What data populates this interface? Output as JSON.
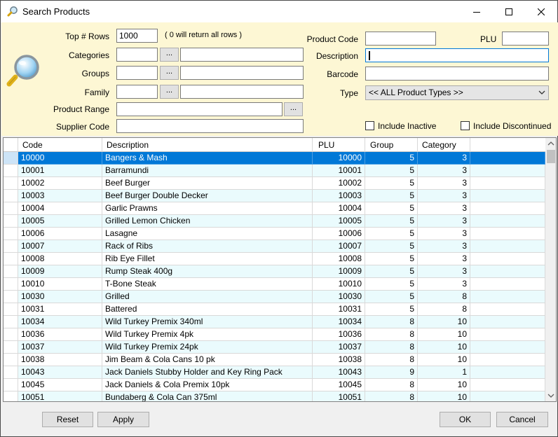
{
  "window": {
    "title": "Search Products",
    "icon": "magnifier-icon"
  },
  "filters": {
    "top_rows": {
      "label": "Top # Rows",
      "value": "1000",
      "hint": "( 0 will return all rows )"
    },
    "categories": {
      "label": "Categories",
      "code": "",
      "name": ""
    },
    "groups": {
      "label": "Groups",
      "code": "",
      "name": ""
    },
    "family": {
      "label": "Family",
      "code": "",
      "name": ""
    },
    "product_range": {
      "label": "Product Range",
      "value": ""
    },
    "supplier_code": {
      "label": "Supplier Code",
      "value": ""
    },
    "product_code": {
      "label": "Product Code",
      "value": ""
    },
    "plu": {
      "label": "PLU",
      "value": ""
    },
    "description": {
      "label": "Description",
      "value": ""
    },
    "barcode": {
      "label": "Barcode",
      "value": ""
    },
    "type": {
      "label": "Type",
      "value": "<< ALL Product Types >>"
    },
    "include_inactive": {
      "label": "Include Inactive",
      "checked": false
    },
    "include_discontinued": {
      "label": "Include Discontinued",
      "checked": false
    },
    "browse_label": "..."
  },
  "table": {
    "columns": [
      "Code",
      "Description",
      "PLU",
      "Group",
      "Category"
    ],
    "selected_row": 0,
    "rows": [
      [
        "10000",
        "Bangers & Mash",
        "10000",
        "5",
        "3"
      ],
      [
        "10001",
        "Barramundi",
        "10001",
        "5",
        "3"
      ],
      [
        "10002",
        "Beef Burger",
        "10002",
        "5",
        "3"
      ],
      [
        "10003",
        "Beef Burger Double Decker",
        "10003",
        "5",
        "3"
      ],
      [
        "10004",
        "Garlic Prawns",
        "10004",
        "5",
        "3"
      ],
      [
        "10005",
        "Grilled Lemon Chicken",
        "10005",
        "5",
        "3"
      ],
      [
        "10006",
        "Lasagne",
        "10006",
        "5",
        "3"
      ],
      [
        "10007",
        "Rack of Ribs",
        "10007",
        "5",
        "3"
      ],
      [
        "10008",
        "Rib Eye Fillet",
        "10008",
        "5",
        "3"
      ],
      [
        "10009",
        "Rump Steak 400g",
        "10009",
        "5",
        "3"
      ],
      [
        "10010",
        "T-Bone Steak",
        "10010",
        "5",
        "3"
      ],
      [
        "10030",
        "Grilled",
        "10030",
        "5",
        "8"
      ],
      [
        "10031",
        "Battered",
        "10031",
        "5",
        "8"
      ],
      [
        "10034",
        "Wild Turkey Premix 340ml",
        "10034",
        "8",
        "10"
      ],
      [
        "10036",
        "Wild Turkey Premix 4pk",
        "10036",
        "8",
        "10"
      ],
      [
        "10037",
        "Wild Turkey Premix 24pk",
        "10037",
        "8",
        "10"
      ],
      [
        "10038",
        "Jim Beam & Cola Cans 10 pk",
        "10038",
        "8",
        "10"
      ],
      [
        "10043",
        "Jack Daniels Stubby Holder and Key Ring Pack",
        "10043",
        "9",
        "1"
      ],
      [
        "10045",
        "Jack Daniels & Cola Premix 10pk",
        "10045",
        "8",
        "10"
      ],
      [
        "10051",
        "Bundaberg & Cola Can 375ml",
        "10051",
        "8",
        "10"
      ]
    ]
  },
  "buttons": {
    "reset": "Reset",
    "apply": "Apply",
    "ok": "OK",
    "cancel": "Cancel"
  }
}
